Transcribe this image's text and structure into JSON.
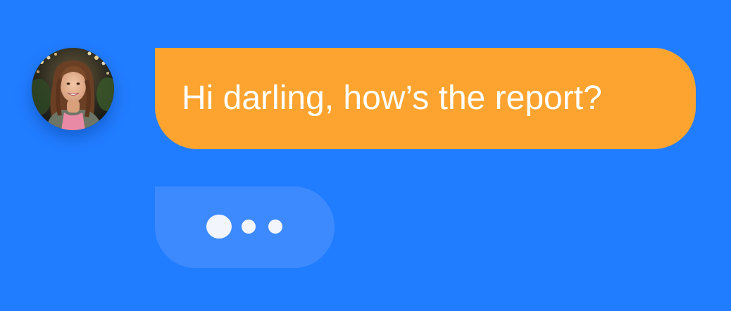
{
  "chat": {
    "incoming_message": "Hi darling, how’s the report?",
    "typing_indicator_dots": 3
  },
  "colors": {
    "background": "#217dff",
    "message_bubble": "#fca42f",
    "typing_bubble": "#3d8aff",
    "message_text": "#ffffff",
    "typing_dot": "#f2f5fb"
  },
  "icons": {
    "avatar": "user-avatar-photo"
  }
}
